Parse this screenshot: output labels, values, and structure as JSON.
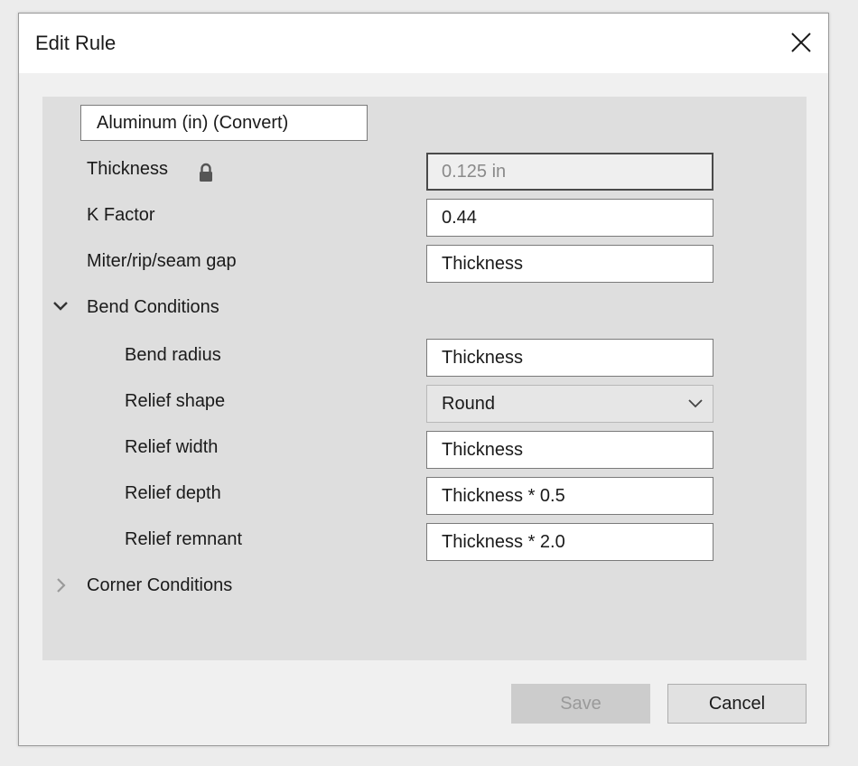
{
  "dialog": {
    "title": "Edit Rule"
  },
  "rule": {
    "name": "Aluminum (in) (Convert)"
  },
  "fields": {
    "thickness": {
      "label": "Thickness",
      "value": "0.125 in",
      "locked": true
    },
    "k_factor": {
      "label": "K Factor",
      "value": "0.44"
    },
    "miter_gap": {
      "label": "Miter/rip/seam gap",
      "value": "Thickness"
    }
  },
  "bend_conditions": {
    "label": "Bend Conditions",
    "expanded": true,
    "bend_radius": {
      "label": "Bend radius",
      "value": "Thickness"
    },
    "relief_shape": {
      "label": "Relief shape",
      "value": "Round"
    },
    "relief_width": {
      "label": "Relief width",
      "value": "Thickness"
    },
    "relief_depth": {
      "label": "Relief depth",
      "value": "Thickness * 0.5"
    },
    "relief_remnant": {
      "label": "Relief remnant",
      "value": "Thickness * 2.0"
    }
  },
  "corner_conditions": {
    "label": "Corner Conditions",
    "expanded": false
  },
  "buttons": {
    "save": "Save",
    "cancel": "Cancel"
  },
  "icons": {
    "close": "close-icon",
    "lock": "lock-icon",
    "expanded": "chevron-down-icon",
    "collapsed": "chevron-right-icon",
    "dropdown": "chevron-down-icon"
  }
}
